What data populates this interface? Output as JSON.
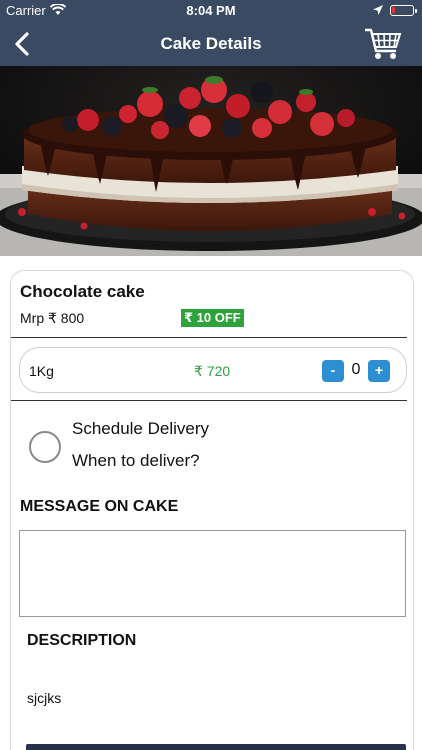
{
  "status_bar": {
    "carrier": "Carrier",
    "time": "8:04 PM",
    "icons": [
      "wifi-icon",
      "location-icon",
      "battery-icon"
    ]
  },
  "nav": {
    "title": "Cake Details",
    "back_icon": "chevron-left-icon",
    "cart_icon": "cart-icon"
  },
  "hero": {
    "image": "chocolate cake with berries"
  },
  "product": {
    "name": "Chocolate cake",
    "mrp": "Mrp ₹ 800",
    "discount": "₹ 10 OFF"
  },
  "variant": {
    "size": "1Kg",
    "price": "₹ 720",
    "minus_label": "-",
    "plus_label": "+",
    "quantity": "0"
  },
  "schedule": {
    "title": "Schedule Delivery",
    "subtitle": "When to deliver?"
  },
  "message": {
    "heading": "MESSAGE ON CAKE",
    "value": ""
  },
  "description": {
    "heading": "DESCRIPTION",
    "text": "sjcjks"
  },
  "colors": {
    "header": "#3a4a63",
    "discount_green": "#2ea23b",
    "qty_blue": "#2d8fd1",
    "bottom_bar": "#27324a"
  }
}
